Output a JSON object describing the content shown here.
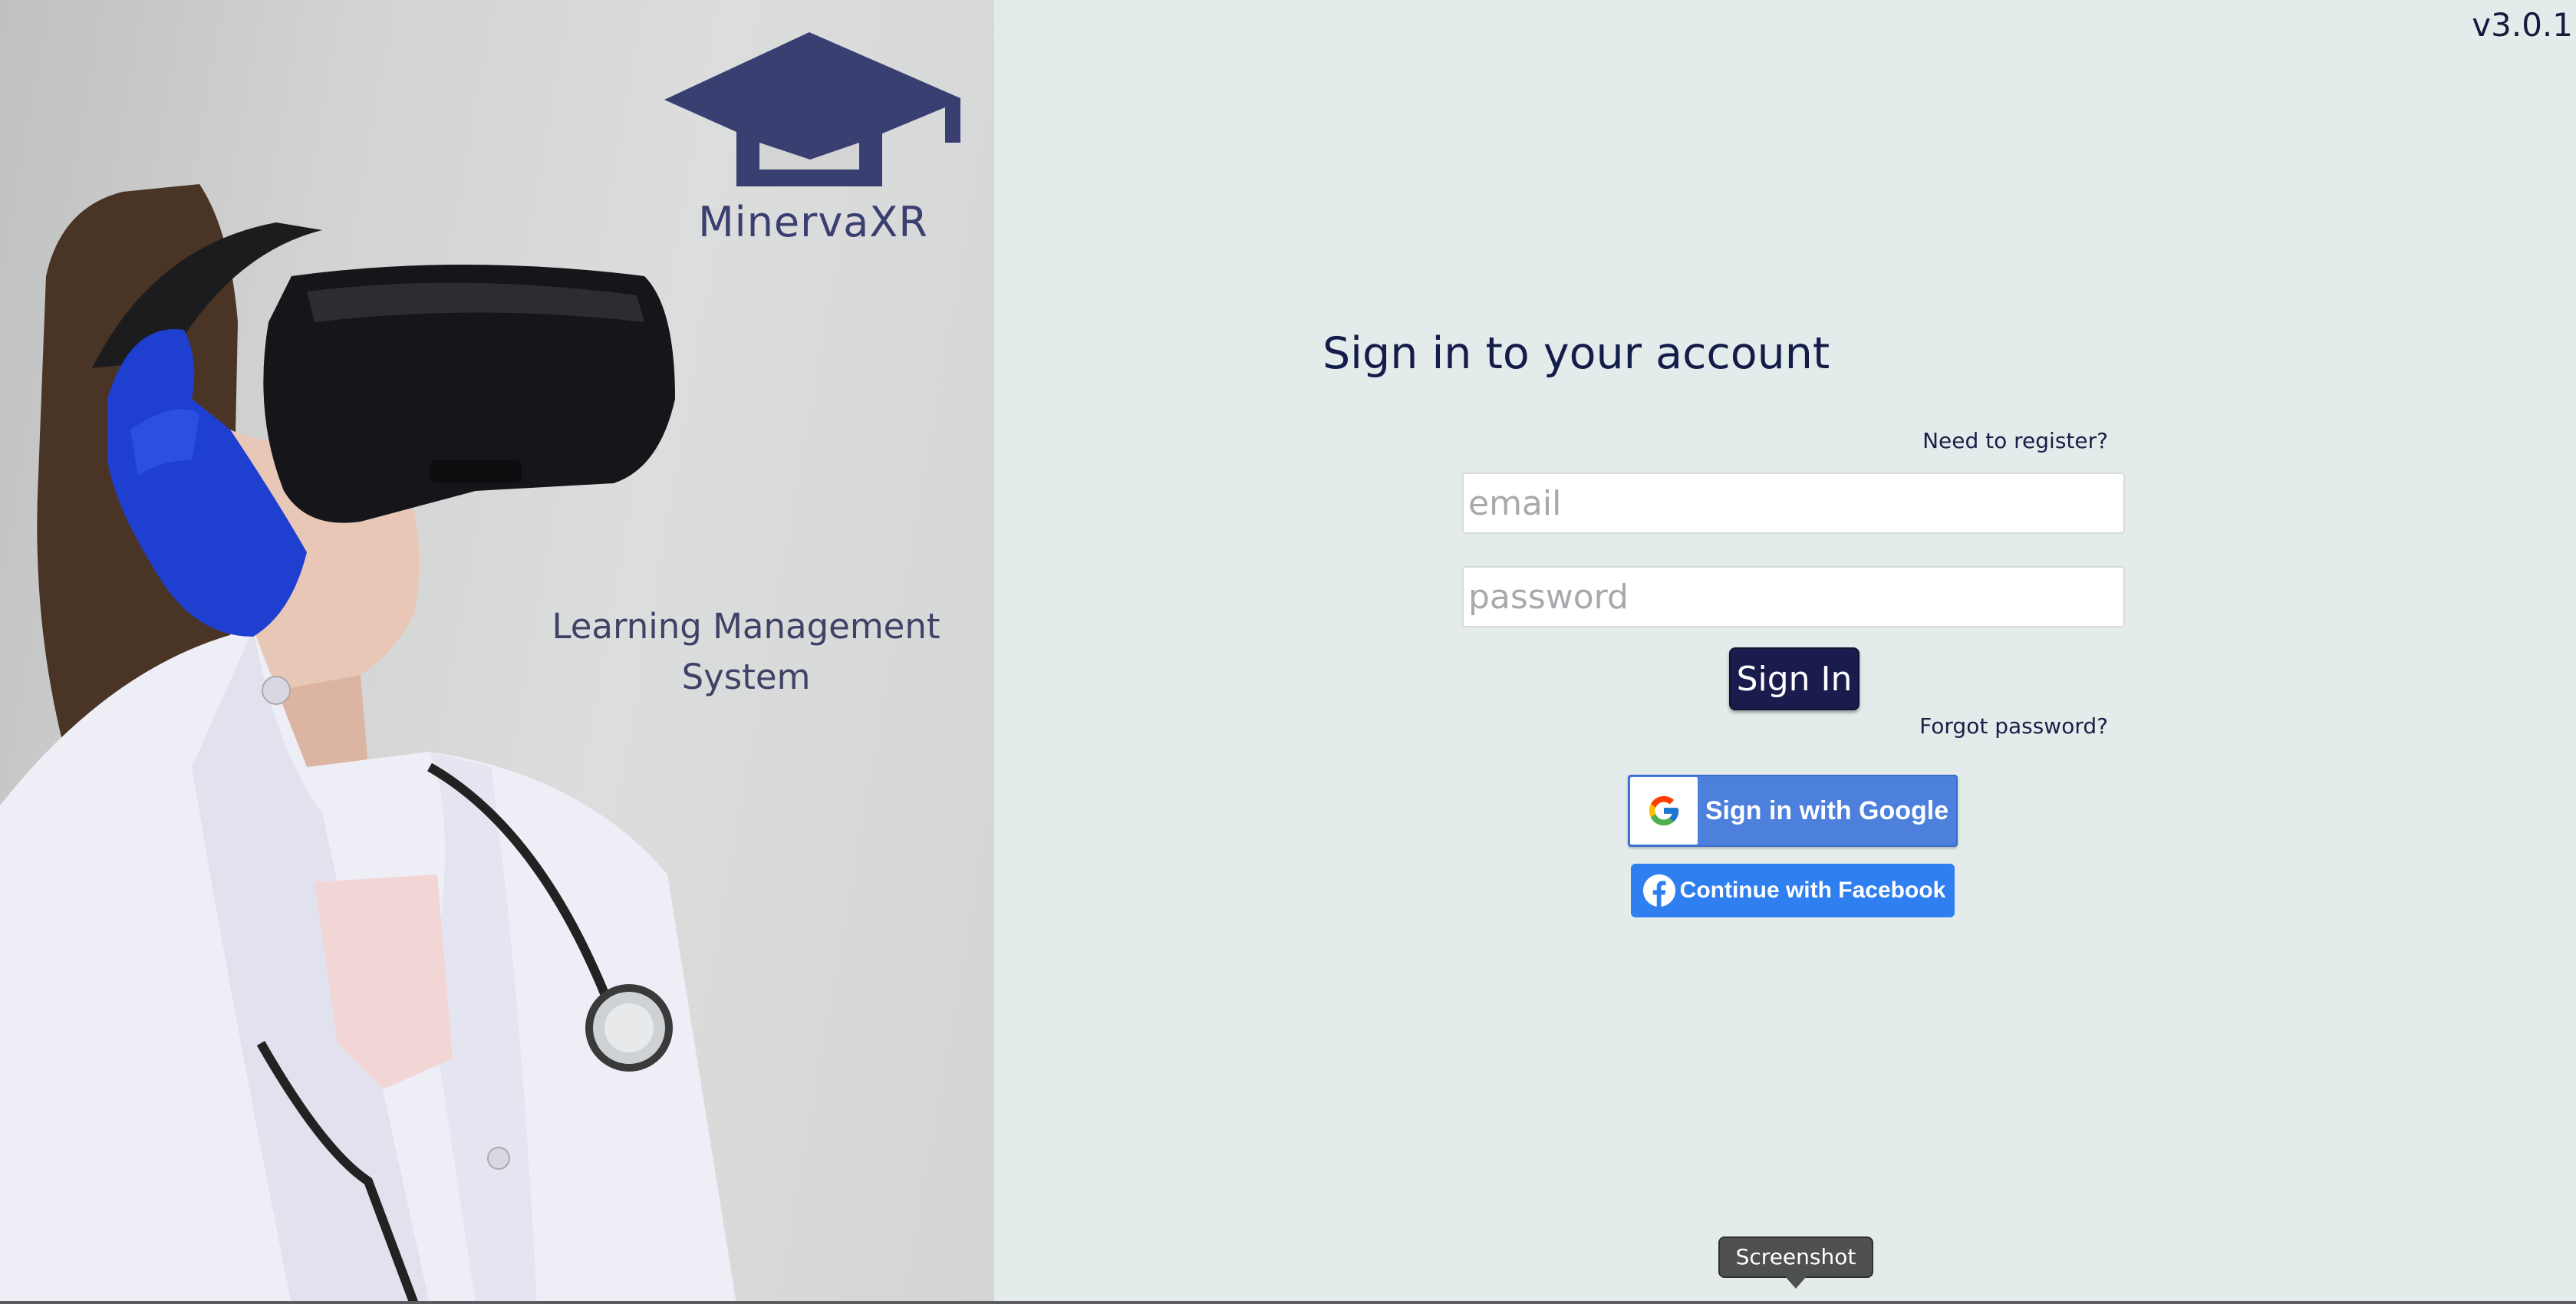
{
  "app": {
    "version": "v3.0.1",
    "brand_name": "MinervaXR",
    "tagline": "Learning Management System"
  },
  "icons": {
    "logo": "graduation-cap-icon",
    "google": "google-icon",
    "facebook": "facebook-icon"
  },
  "colors": {
    "panel_background": "#e4eceb",
    "brand": "#3a3f72",
    "title": "#141c4a",
    "signin_button": "#1b1c4e",
    "google_button": "#4d7fdc",
    "facebook_button": "#2f7ff0"
  },
  "form": {
    "title": "Sign in to your account",
    "register_link": "Need to register?",
    "email_placeholder": "email",
    "password_placeholder": "password",
    "email_value": "",
    "password_value": "",
    "signin_label": "Sign In",
    "forgot_link": "Forgot password?"
  },
  "social": {
    "google_label": "Sign in with Google",
    "facebook_label": "Continue with Facebook"
  },
  "tooltip": {
    "text": "Screenshot"
  }
}
